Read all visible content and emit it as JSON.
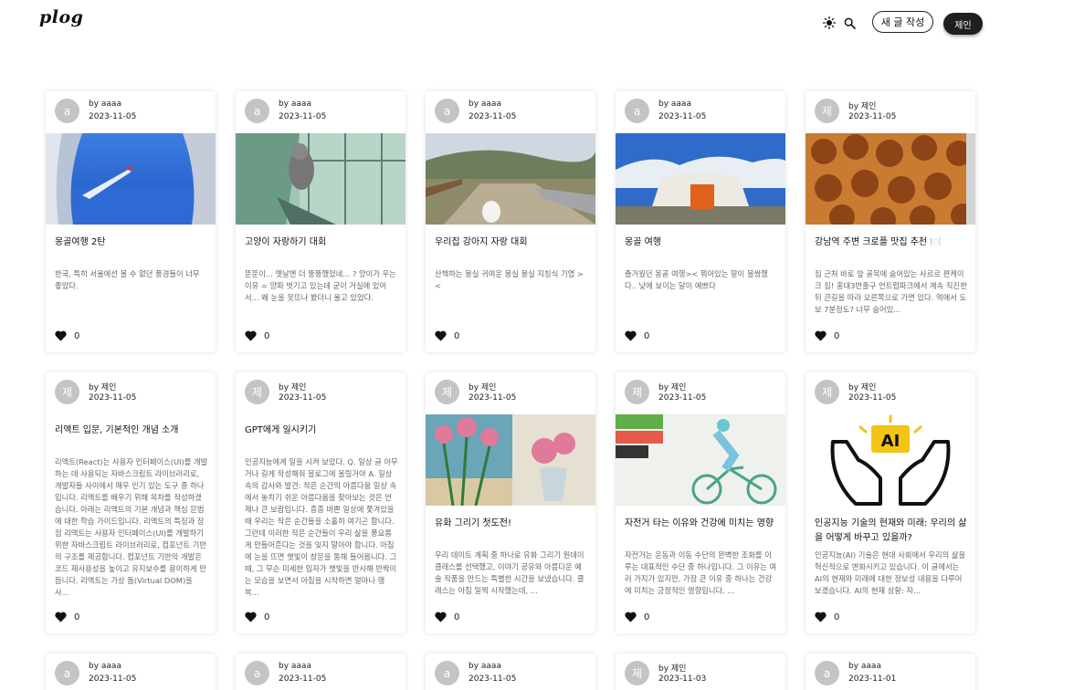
{
  "header": {
    "logo": "plog",
    "sun_icon": "sun-icon",
    "search_icon": "search-icon",
    "write_label": "새 글 작성",
    "user_label": "제인"
  },
  "posts": [
    {
      "avatar": "a",
      "author": "by aaaa",
      "date": "2023-11-05",
      "title": "몽골여행 2탄",
      "summary": "한국, 특히 서울에선 볼 수 없던 풍경들이 너무 좋았다.",
      "likes": "0",
      "image": "airplane-wing-sky"
    },
    {
      "avatar": "a",
      "author": "by aaaa",
      "date": "2023-11-05",
      "title": "고양이 자랑하기 대회",
      "summary": "뚠뚠이... 옛날엔 더 뚱뚱했었네... ? 양이가 우는 이유 = 양파 벗기고 있는데 굳이 거실에 있어서... 왜 눈을 못뜨나 봤더니 울고 있었다.",
      "likes": "0",
      "image": "cat-in-window"
    },
    {
      "avatar": "a",
      "author": "by aaaa",
      "date": "2023-11-05",
      "title": "우리집 강아지 자랑 대회",
      "summary": "산책하는 뭉실 귀여운 뭉실 뭉실 지칭식 기염 ><",
      "likes": "0",
      "image": "dog-on-path"
    },
    {
      "avatar": "a",
      "author": "by aaaa",
      "date": "2023-11-05",
      "title": "몽골 여행",
      "summary": "즐거웠던 몽골 여행>< 뭐어있는 말이 불쌍했다.. 낮에 보이는 달이 예쁘다",
      "likes": "0",
      "image": "mongolian-ger"
    },
    {
      "avatar": "제",
      "author": "by 제인",
      "date": "2023-11-05",
      "title": "강남역 주변 크로플 맛집 추천 🍽️",
      "summary": "집 근처 바로 앞 골목에 숨어있는 사르르 편케이크 집! 홍대3번출구 언트럼파크에서 계속 직진한 뒤 큰길을 따라 오른쪽으로 가면 있다. 역에서 도보 7분정도? 너무 숨어있...",
      "likes": "0",
      "image": "croffles"
    },
    {
      "avatar": "제",
      "author": "by 제인",
      "date": "2023-11-05",
      "title": "리액트 입문, 기본적인 개념 소개",
      "summary": "리액트(React)는 사용자 인터페이스(UI)를 개발하는 데 사용되는 자바스크립트 라이브러리로, 개발자들 사이에서 매우 인기 있는 도구 중 하나입니다. 리액트를 배우기 위해 목차를 작성하겠습니다. 아래는 리액트의 기본 개념과 핵심 문법에 대한 학습 가이드입니다. 리액트의 특징과 장점 리액트는 사용자 인터페이스(UI)를 개발하기 위한 자바스크립트 라이브러리로, 컴포넌트 기반의 구조를 제공합니다. 컴포넌트 기반의 개발은 코드 재사용성을 높이고 유지보수를 용이하게 만듭니다. 리액트는 가상 돔(Virtual DOM)을 사...",
      "likes": "0",
      "image": ""
    },
    {
      "avatar": "제",
      "author": "by 제인",
      "date": "2023-11-05",
      "title": "GPT에게 일시키기",
      "summary": "인공지능에게 일을 시켜 보았다. Q. 일상 글 아무거나 길게 작성해줘 블로그에 올릴거야 A. 일상 속의 감사와 발견: 작은 순간의 아름다움 일상 속에서 놓치기 쉬운 아름다움을 찾아보는 것은 언제나 큰 보람입니다. 종종 바쁜 일상에 쫓겨있을 때 우리는 작은 순간들을 소홀히 여기곤 합니다. 그런데 이러한 작은 순간들이 우리 삶을 풍요롭게 만들어준다는 것을 잊지 말아야 합니다. 아침에 눈을 뜨면 햇빛이 창문을 통해 들어옵니다. 그때, 그 무슨 미세한 입자가 햇빛을 반사해 반짝이는 모습을 보면서 아침을 시작하면 얼마나 행복...",
      "likes": "0",
      "image": ""
    },
    {
      "avatar": "제",
      "author": "by 제인",
      "date": "2023-11-05",
      "title": "유화 그리기 첫도전!",
      "summary": "우리 데이트 계획 중 하나로 유화 그리기 원데이클래스를 선택했고, 이야기 공유와 아름다운 예술 작품을 만드는 특별한 시간을 보냈습니다. 클래스는 아침 일찍 시작했는데, ...",
      "likes": "0",
      "image": "flower-painting"
    },
    {
      "avatar": "제",
      "author": "by 제인",
      "date": "2023-11-05",
      "title": "자전거 타는 이유와 건강에 미치는 영향",
      "summary": "자전거는 운동과 이동 수단의 완벽한 조화를 이루는 대표적인 수단 중 하나입니다. 그 이유는 여러 가지가 있지만, 가장 큰 이유 중 하나는 건강에 미치는 긍정적인 영향입니다. ...",
      "likes": "0",
      "image": "cycling-posture-infographic"
    },
    {
      "avatar": "제",
      "author": "by 제인",
      "date": "2023-11-05",
      "title": "인공지능 기술의 현재와 미래: 우리의 삶을 어떻게 바꾸고 있을까?",
      "summary": "인공지능(AI) 기술은 현대 사회에서 우리의 삶을 혁신적으로 변화시키고 있습니다. 이 글에서는 AI의 현재와 미래에 대한 정보성 내용을 다루어 보겠습니다. AI의 현재 상황: 자...",
      "likes": "0",
      "image": "ai-hands-icon"
    },
    {
      "avatar": "a",
      "author": "by aaaa",
      "date": "2023-11-05",
      "title": "",
      "summary": "",
      "likes": "",
      "image": ""
    },
    {
      "avatar": "a",
      "author": "by aaaa",
      "date": "2023-11-05",
      "title": "",
      "summary": "",
      "likes": "",
      "image": ""
    },
    {
      "avatar": "a",
      "author": "by aaaa",
      "date": "2023-11-05",
      "title": "",
      "summary": "",
      "likes": "",
      "image": ""
    },
    {
      "avatar": "제",
      "author": "by 제인",
      "date": "2023-11-03",
      "title": "",
      "summary": "",
      "likes": "",
      "image": ""
    },
    {
      "avatar": "a",
      "author": "by aaaa",
      "date": "2023-11-01",
      "title": "",
      "summary": "",
      "likes": "",
      "image": ""
    }
  ],
  "ai_badge": "AI"
}
